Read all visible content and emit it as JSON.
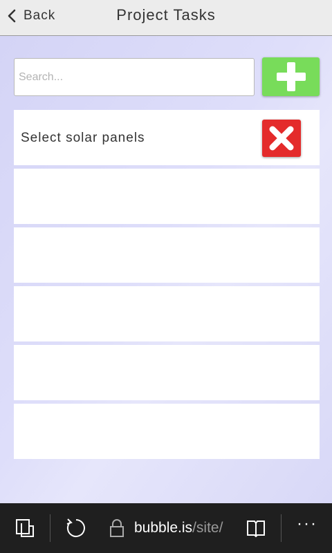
{
  "header": {
    "back_label": "Back",
    "title": "Project Tasks"
  },
  "search": {
    "placeholder": "Search...",
    "value": ""
  },
  "tasks": [
    {
      "label": "Select solar panels"
    },
    {
      "label": ""
    },
    {
      "label": ""
    },
    {
      "label": ""
    },
    {
      "label": ""
    },
    {
      "label": ""
    }
  ],
  "browser": {
    "url_host": "bubble.is",
    "url_path": "/site/",
    "more_label": "···"
  },
  "colors": {
    "add": "#78dc5a",
    "delete": "#e42b2b",
    "background": "#dcdcf8",
    "header": "#ececec",
    "toolbar": "#1f1f1f"
  },
  "icons": {
    "back": "chevron-left-icon",
    "add": "plus-icon",
    "delete": "close-icon",
    "tabs": "tabs-icon",
    "refresh": "refresh-icon",
    "lock": "lock-icon",
    "reading": "reading-view-icon",
    "more": "more-icon"
  }
}
